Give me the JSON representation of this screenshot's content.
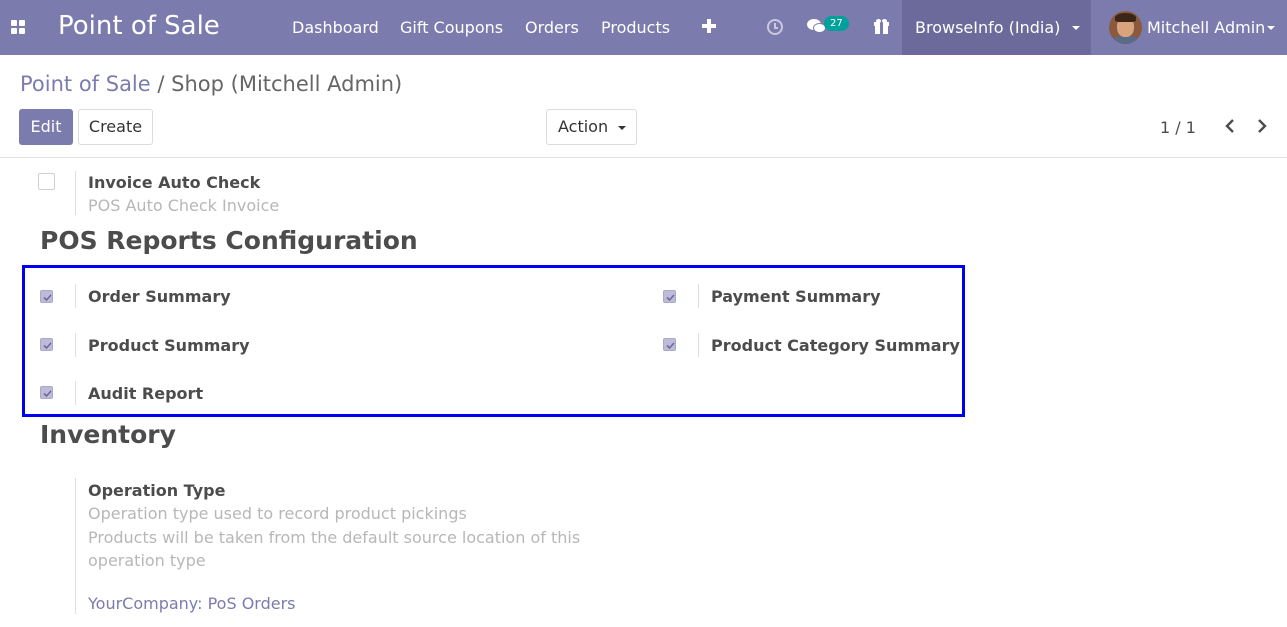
{
  "navbar": {
    "app_title": "Point of Sale",
    "menu": [
      "Dashboard",
      "Gift Coupons",
      "Orders",
      "Products"
    ],
    "icons": [
      "apps-icon",
      "plus-icon",
      "clock-icon",
      "chat-icon",
      "gift-icon"
    ],
    "messages_count": "27",
    "company": "BrowseInfo (India)",
    "user": "Mitchell Admin",
    "colors": {
      "navbar": "#7c7bad",
      "company_bg": "#6b6a9a",
      "badge": "#00a09d"
    }
  },
  "breadcrumb": {
    "parent": "Point of Sale",
    "separator": "/",
    "current": "Shop (Mitchell Admin)"
  },
  "buttons": {
    "edit": "Edit",
    "create": "Create",
    "action": "Action"
  },
  "pager": {
    "value": "1 / 1"
  },
  "form": {
    "invoice_auto_check": {
      "label": "Invoice Auto Check",
      "help": "POS Auto Check Invoice",
      "checked": false
    },
    "pos_reports": {
      "title": "POS Reports Configuration",
      "items": [
        {
          "label": "Order Summary",
          "checked": true
        },
        {
          "label": "Payment Summary",
          "checked": true
        },
        {
          "label": "Product Summary",
          "checked": true
        },
        {
          "label": "Product Category Summary",
          "checked": true
        },
        {
          "label": "Audit Report",
          "checked": true
        }
      ],
      "highlight_color": "#0000ee"
    },
    "inventory": {
      "title": "Inventory",
      "operation_type": {
        "label": "Operation Type",
        "help_lines": [
          "Operation type used to record product pickings",
          "Products will be taken from the default source location of this",
          "operation type"
        ],
        "value": "YourCompany: PoS Orders"
      }
    }
  }
}
